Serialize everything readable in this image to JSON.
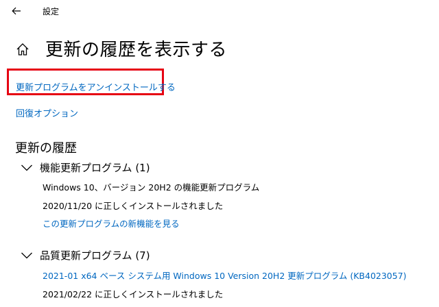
{
  "window": {
    "title": "設定"
  },
  "page": {
    "title": "更新の履歴を表示する"
  },
  "links": {
    "uninstall_updates": "更新プログラムをアンインストールする",
    "recovery_options": "回復オプション"
  },
  "history": {
    "title": "更新の履歴",
    "groups": [
      {
        "title": "機能更新プログラム (1)",
        "items": [
          {
            "name": "Windows 10、バージョン 20H2 の機能更新プログラム",
            "status": "2020/11/20 に正しくインストールされました",
            "link": "この更新プログラムの新機能を見る"
          }
        ]
      },
      {
        "title": "品質更新プログラム (7)",
        "items": [
          {
            "name": "2021-01 x64 ベース システム用 Windows 10 Version 20H2 更新プログラム (KB4023057)",
            "status": "2021/02/22 に正しくインストールされました"
          }
        ]
      }
    ]
  },
  "colors": {
    "link": "#0067c0",
    "highlight": "#e60012"
  },
  "icons": {
    "back": "back-arrow-icon",
    "home": "home-icon",
    "expand": "chevron-down-icon"
  }
}
